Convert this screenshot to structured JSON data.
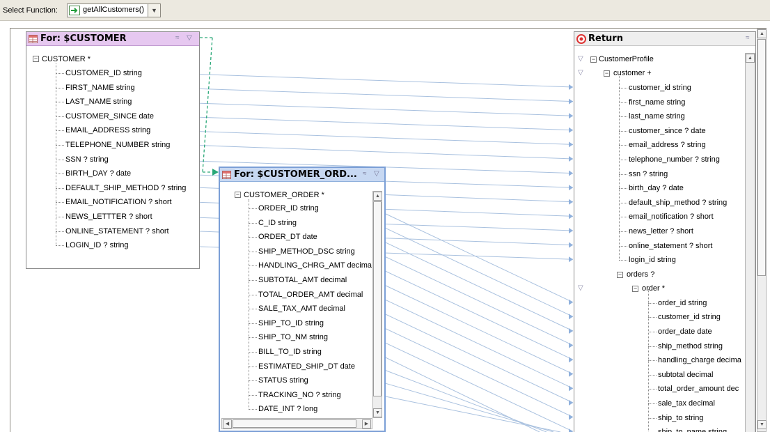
{
  "toolbar": {
    "label": "Select Function:",
    "function_value": "getAllCustomers()"
  },
  "customer_box": {
    "title": "For: $CUSTOMER",
    "root": "CUSTOMER *",
    "fields": [
      "CUSTOMER_ID string",
      "FIRST_NAME string",
      "LAST_NAME string",
      "CUSTOMER_SINCE date",
      "EMAIL_ADDRESS string",
      "TELEPHONE_NUMBER string",
      "SSN ? string",
      "BIRTH_DAY ? date",
      "DEFAULT_SHIP_METHOD ? string",
      "EMAIL_NOTIFICATION ? short",
      "NEWS_LETTTER ? short",
      "ONLINE_STATEMENT ? short",
      "LOGIN_ID ? string"
    ]
  },
  "order_box": {
    "title": "For: $CUSTOMER_ORD...",
    "root": "CUSTOMER_ORDER *",
    "fields": [
      "ORDER_ID string",
      "C_ID string",
      "ORDER_DT date",
      "SHIP_METHOD_DSC string",
      "HANDLING_CHRG_AMT decima",
      "SUBTOTAL_AMT decimal",
      "TOTAL_ORDER_AMT decimal",
      "SALE_TAX_AMT decimal",
      "SHIP_TO_ID string",
      "SHIP_TO_NM string",
      "BILL_TO_ID string",
      "ESTIMATED_SHIP_DT date",
      "STATUS string",
      "TRACKING_NO ? string",
      "DATE_INT ? long"
    ]
  },
  "return_box": {
    "title": "Return",
    "root": "CustomerProfile",
    "customer": "customer +",
    "customer_fields": [
      "customer_id string",
      "first_name string",
      "last_name string",
      "customer_since ? date",
      "email_address ? string",
      "telephone_number ? string",
      "ssn ? string",
      "birth_day ? date",
      "default_ship_method ? string",
      "email_notification ? short",
      "news_letter ? short",
      "online_statement ? short",
      "login_id string"
    ],
    "orders": "orders ?",
    "order": "order *",
    "order_fields": [
      "order_id string",
      "customer_id string",
      "order_date date",
      "ship_method string",
      "handling_charge decima",
      "subtotal decimal",
      "total_order_amount dec",
      "sale_tax decimal",
      "ship_to string",
      "ship_to_name string"
    ]
  },
  "colors": {
    "customer_header": "#e6c8f0",
    "order_header": "#c7d8f2",
    "order_border": "#7b9fd6",
    "mapping_line": "#a9c1df",
    "scope_line": "#2aa878"
  }
}
